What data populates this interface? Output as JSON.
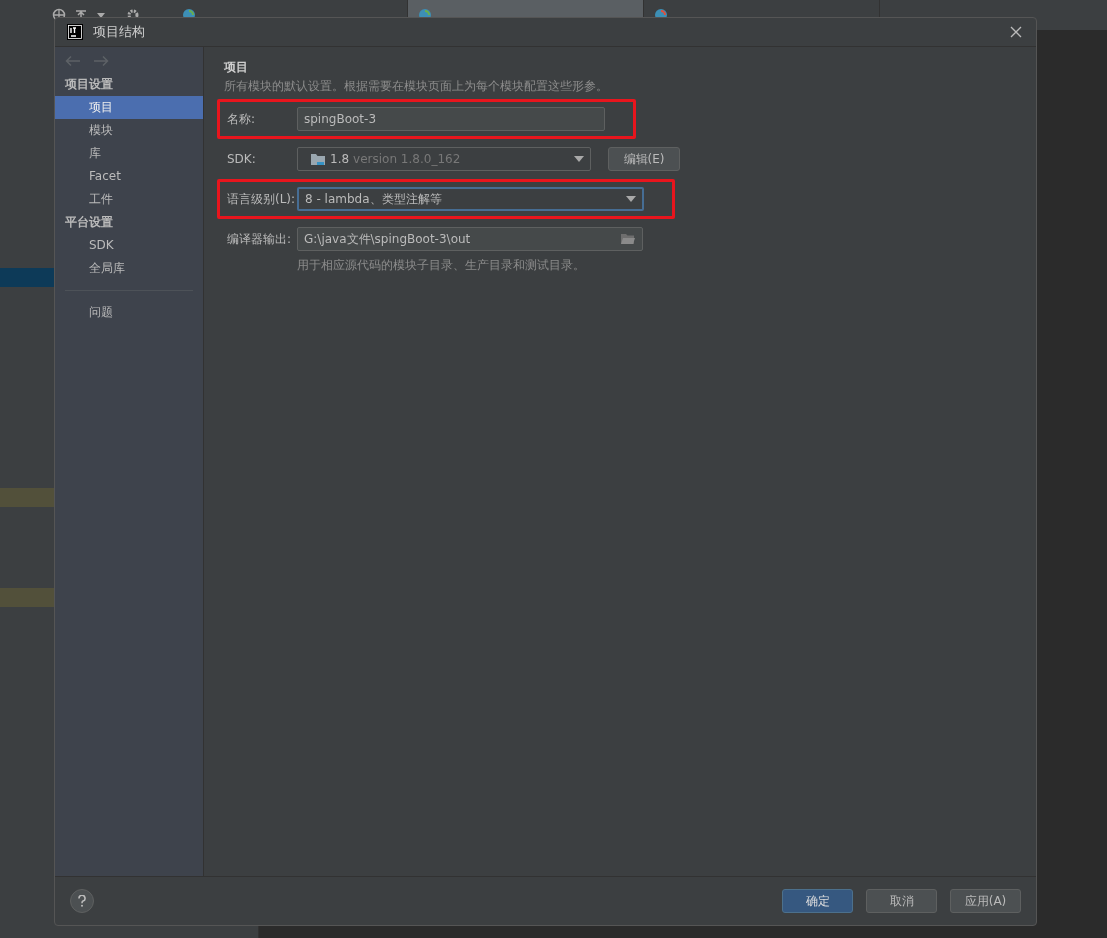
{
  "editor_tabs": [
    {
      "selected": false
    },
    {
      "selected": true
    },
    {
      "selected": false
    }
  ],
  "window": {
    "title": "项目结构"
  },
  "sidebar": {
    "sections": [
      {
        "heading": "项目设置",
        "items": [
          {
            "label": "项目",
            "selected": true
          },
          {
            "label": "模块",
            "selected": false
          },
          {
            "label": "库",
            "selected": false
          },
          {
            "label": "Facet",
            "selected": false
          },
          {
            "label": "工件",
            "selected": false
          }
        ]
      },
      {
        "heading": "平台设置",
        "items": [
          {
            "label": "SDK",
            "selected": false
          },
          {
            "label": "全局库",
            "selected": false
          }
        ]
      }
    ],
    "extra_items": [
      {
        "label": "问题",
        "selected": false
      }
    ]
  },
  "panel": {
    "heading": "项目",
    "description": "所有模块的默认设置。根据需要在模块页面上为每个模块配置这些形参。",
    "fields": [
      {
        "kind": "text",
        "label": "名称:",
        "value": "spingBoot-3",
        "highlighted": true,
        "focused": false
      },
      {
        "kind": "sdk",
        "label": "SDK:",
        "value": "1.8",
        "detail": "version 1.8.0_162",
        "button": "编辑(E)",
        "highlighted": false,
        "focused": false
      },
      {
        "kind": "dropdown",
        "label": "语言级别(L):",
        "value": "8 - lambda、类型注解等",
        "highlighted": true,
        "focused": true
      },
      {
        "kind": "path",
        "label": "编译器输出:",
        "value": "G:\\java文件\\spingBoot-3\\out",
        "hint": "用于相应源代码的模块子目录、生产目录和测试目录。",
        "highlighted": false,
        "focused": false
      }
    ]
  },
  "buttons": [
    {
      "label": "确定",
      "kind": "primary"
    },
    {
      "label": "取消",
      "kind": "normal"
    },
    {
      "label": "应用(A)",
      "kind": "normal"
    }
  ]
}
